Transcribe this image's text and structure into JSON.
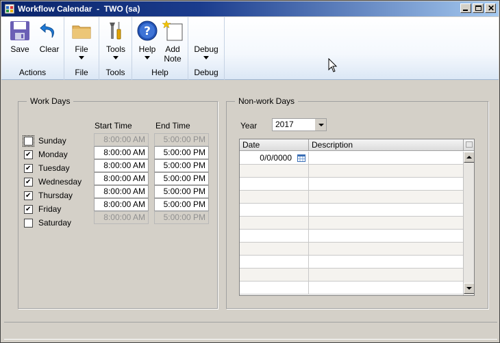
{
  "window": {
    "title": "Workflow Calendar  -  TWO (sa)",
    "icon": "workflow-calendar-icon"
  },
  "ribbon": {
    "groups": [
      {
        "label": "Actions",
        "buttons": [
          {
            "label": "Save",
            "icon": "save-icon"
          },
          {
            "label": "Clear",
            "icon": "undo-icon"
          }
        ]
      },
      {
        "label": "File",
        "buttons": [
          {
            "label": "File",
            "icon": "folder-icon"
          }
        ]
      },
      {
        "label": "Tools",
        "buttons": [
          {
            "label": "Tools",
            "icon": "tools-icon"
          }
        ]
      },
      {
        "label": "Help",
        "buttons": [
          {
            "label": "Help",
            "icon": "help-icon"
          },
          {
            "label1": "Add",
            "label2": "Note",
            "icon": "add-note-icon"
          }
        ]
      },
      {
        "label": "Debug",
        "buttons": [
          {
            "label": "Debug"
          }
        ]
      }
    ]
  },
  "work_days": {
    "legend": "Work Days",
    "start_header": "Start Time",
    "end_header": "End Time",
    "days": [
      {
        "name": "Sunday",
        "checked": false,
        "start": "8:00:00 AM",
        "end": "5:00:00 PM",
        "enabled": false
      },
      {
        "name": "Monday",
        "checked": true,
        "start": "8:00:00 AM",
        "end": "5:00:00 PM",
        "enabled": true
      },
      {
        "name": "Tuesday",
        "checked": true,
        "start": "8:00:00 AM",
        "end": "5:00:00 PM",
        "enabled": true
      },
      {
        "name": "Wednesday",
        "checked": true,
        "start": "8:00:00 AM",
        "end": "5:00:00 PM",
        "enabled": true
      },
      {
        "name": "Thursday",
        "checked": true,
        "start": "8:00:00 AM",
        "end": "5:00:00 PM",
        "enabled": true
      },
      {
        "name": "Friday",
        "checked": true,
        "start": "8:00:00 AM",
        "end": "5:00:00 PM",
        "enabled": true
      },
      {
        "name": "Saturday",
        "checked": false,
        "start": "8:00:00 AM",
        "end": "5:00:00 PM",
        "enabled": false
      }
    ]
  },
  "non_work_days": {
    "legend": "Non-work Days",
    "year_label": "Year",
    "year_value": "2017",
    "grid": {
      "headers": [
        "Date",
        "Description"
      ],
      "rows": [
        {
          "date": "0/0/0000",
          "description": ""
        }
      ]
    }
  },
  "colors": {
    "title_start": "#0a246a",
    "title_end": "#a6caf0",
    "window_bg": "#d4d0c8"
  }
}
